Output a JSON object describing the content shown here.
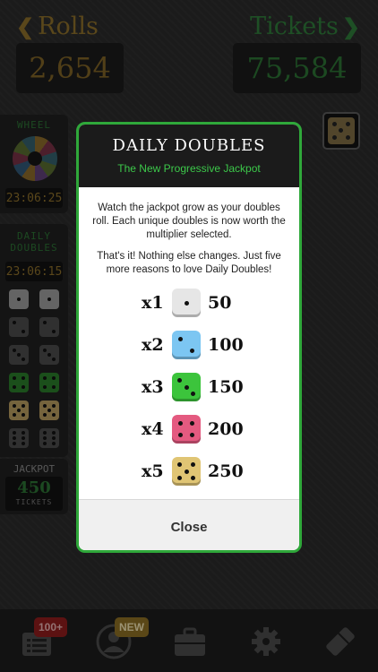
{
  "header": {
    "rolls_label": "Rolls",
    "rolls_value": "2,654",
    "tickets_label": "Tickets",
    "tickets_value": "75,584"
  },
  "sidebar": {
    "wheel_title": "WHEEL",
    "wheel_timer": "23:06:25",
    "daily_doubles_title_1": "DAILY",
    "daily_doubles_title_2": "DOUBLES",
    "daily_doubles_timer": "23:06:15",
    "jackpot_label": "JACKPOT",
    "jackpot_value": "450",
    "jackpot_unit": "TICKETS"
  },
  "modal": {
    "title": "DAILY DOUBLES",
    "subtitle": "The New Progressive Jackpot",
    "paragraph_1": "Watch the jackpot grow as your doubles roll. Each unique doubles is now worth the multiplier selected.",
    "paragraph_2": "That's it! Nothing else changes. Just five more reasons to love Daily Doubles!",
    "rows": [
      {
        "multiplier": "x1",
        "value": "50",
        "die_color": "#e6e6e6",
        "pips": 1
      },
      {
        "multiplier": "x2",
        "value": "100",
        "die_color": "#7cc6f2",
        "pips": 2
      },
      {
        "multiplier": "x3",
        "value": "150",
        "die_color": "#3cc43c",
        "pips": 3
      },
      {
        "multiplier": "x4",
        "value": "200",
        "die_color": "#e45a80",
        "pips": 4
      },
      {
        "multiplier": "x5",
        "value": "250",
        "die_color": "#e0c574",
        "pips": 5
      }
    ],
    "close_label": "Close"
  },
  "bottom_bar": {
    "tickets_badge": "100+",
    "profile_badge": "NEW"
  },
  "colors": {
    "accent_green": "#2fa83a",
    "gold": "#8a6d2a"
  }
}
